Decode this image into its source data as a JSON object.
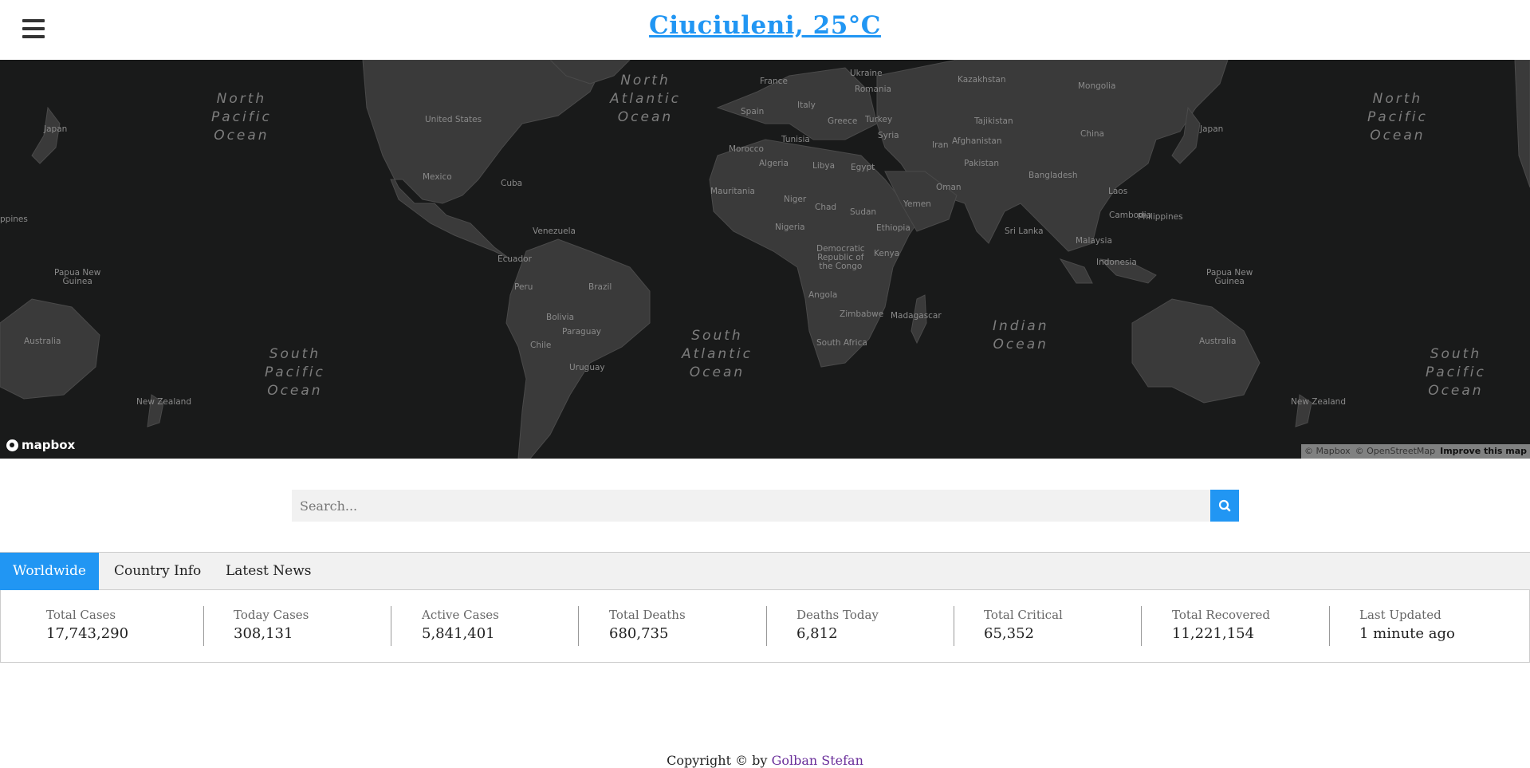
{
  "header": {
    "title": "Ciuciuleni, 25°C"
  },
  "map": {
    "ocean_labels": [
      {
        "name": "north-pacific-ocean-west",
        "text": "North\nPacific\nOcean"
      },
      {
        "name": "north-atlantic-ocean",
        "text": "North\nAtlantic\nOcean"
      },
      {
        "name": "north-pacific-ocean-east",
        "text": "North\nPacific\nOcean"
      },
      {
        "name": "south-pacific-ocean-west",
        "text": "South\nPacific\nOcean"
      },
      {
        "name": "south-atlantic-ocean",
        "text": "South\nAtlantic\nOcean"
      },
      {
        "name": "indian-ocean",
        "text": "Indian\nOcean"
      },
      {
        "name": "south-pacific-ocean-east",
        "text": "South\nPacific\nOcean"
      }
    ],
    "country_labels": [
      "Japan",
      "United States",
      "Mexico",
      "Cuba",
      "ppines",
      "Papua New\nGuinea",
      "Australia",
      "New Zealand",
      "Venezuela",
      "Ecuador",
      "Peru",
      "Brazil",
      "Bolivia",
      "Paraguay",
      "Chile",
      "Uruguay",
      "France",
      "Ukraine",
      "Romania",
      "Italy",
      "Spain",
      "Greece",
      "Turkey",
      "Kazakhstan",
      "Mongolia",
      "Tajikistan",
      "Afghanistan",
      "Iran",
      "Syria",
      "Tunisia",
      "Morocco",
      "Algeria",
      "Libya",
      "Egypt",
      "Mauritania",
      "Niger",
      "Chad",
      "Sudan",
      "Nigeria",
      "Ethiopia",
      "Democratic\nRepublic of\nthe Congo",
      "Kenya",
      "Angola",
      "Zimbabwe",
      "Madagascar",
      "South Africa",
      "Oman",
      "Yemen",
      "Pakistan",
      "China",
      "Bangladesh",
      "Laos",
      "Cambodia",
      "Sri Lanka",
      "Malaysia",
      "Indonesia",
      "Philippines",
      "Japan",
      "Papua New\nGuinea",
      "Australia",
      "New Zealand"
    ],
    "logo_text": "mapbox",
    "attribution": {
      "mapbox": "© Mapbox",
      "osm": "© OpenStreetMap",
      "improve": "Improve this map"
    }
  },
  "search": {
    "placeholder": "Search...",
    "button_icon": "search-icon"
  },
  "tabs": [
    {
      "label": "Worldwide",
      "active": true
    },
    {
      "label": "Country Info",
      "active": false
    },
    {
      "label": "Latest News",
      "active": false
    }
  ],
  "stats": [
    {
      "label": "Total Cases",
      "value": "17,743,290"
    },
    {
      "label": "Today Cases",
      "value": "308,131"
    },
    {
      "label": "Active Cases",
      "value": "5,841,401"
    },
    {
      "label": "Total Deaths",
      "value": "680,735"
    },
    {
      "label": "Deaths Today",
      "value": "6,812"
    },
    {
      "label": "Total Critical",
      "value": "65,352"
    },
    {
      "label": "Total Recovered",
      "value": "11,221,154"
    },
    {
      "label": "Last Updated",
      "value": "1 minute ago"
    }
  ],
  "footer": {
    "prefix": "Copyright © by",
    "author": "Golban Stefan"
  },
  "colors": {
    "accent": "#2196f3",
    "map_bg": "#191a1a",
    "land": "#3a3a3a"
  }
}
